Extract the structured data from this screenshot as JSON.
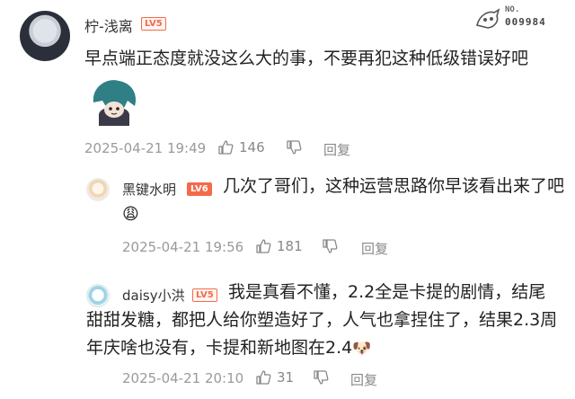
{
  "watermark": {
    "label": "NO.",
    "number": "009984"
  },
  "main_comment": {
    "username": "柠-浅离",
    "level": "LV5",
    "text": "早点端正态度就没这么大的事，不要再犯这种低级错误好吧",
    "time": "2025-04-21 19:49",
    "likes": "146",
    "reply_label": "回复"
  },
  "replies": [
    {
      "username": "黑键水明",
      "level": "LV6",
      "text": "几次了哥们，这种运营思路你早该看出来了吧",
      "emoji": "😩",
      "time": "2025-04-21 19:56",
      "likes": "181",
      "reply_label": "回复"
    },
    {
      "username": "daisy小洪",
      "level": "LV5",
      "text": "我是真看不懂，2.2全是卡提的剧情，结尾甜甜发糖，都把人给你塑造好了，人气也拿捏住了，结果2.3周年庆啥也没有，卡提和新地图在2.4",
      "emoji": "🐶",
      "time": "2025-04-21 20:10",
      "likes": "31",
      "reply_label": "回复"
    }
  ]
}
